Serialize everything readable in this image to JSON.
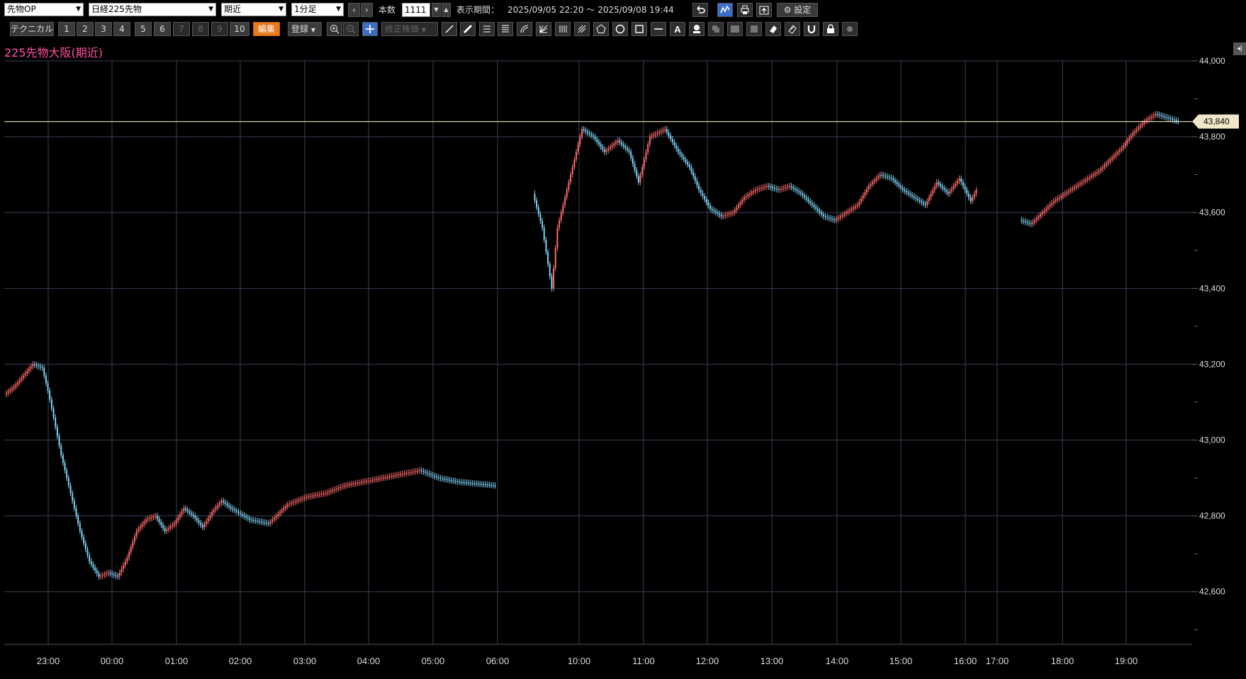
{
  "toolbar": {
    "category_select": "先物OP",
    "symbol_select": "日経225先物",
    "contract_select": "期近",
    "interval_select": "1分足",
    "prev_label": "‹",
    "next_label": "›",
    "bars_label": "本数",
    "bars_value": "1111",
    "period_label": "表示期間：",
    "period_value": "2025/09/05 22:20 ～ 2025/09/08 19:44",
    "settings_label": "設定",
    "technical_label": "テクニカル",
    "presets": [
      "1",
      "2",
      "3",
      "4",
      "5",
      "6",
      "7",
      "8",
      "9",
      "10"
    ],
    "edit_label": "編集",
    "register_label": "登録",
    "adjust_label": "修正株価"
  },
  "chart_title": "225先物大阪(期近)",
  "chart_data": {
    "type": "candlestick",
    "title": "225先物大阪(期近)",
    "x_tick_labels": [
      "23:00",
      "00:00",
      "01:00",
      "02:00",
      "03:00",
      "04:00",
      "05:00",
      "06:00",
      "10:00",
      "11:00",
      "12:00",
      "13:00",
      "14:00",
      "15:00",
      "16:00",
      "17:00",
      "18:00",
      "19:00"
    ],
    "y_tick_labels": [
      "44,000",
      "43,800",
      "43,600",
      "43,400",
      "43,200",
      "43,000",
      "42,800",
      "42,600"
    ],
    "ylim": [
      42480,
      44000
    ],
    "current_price_label": "43,840",
    "current_price": 43840,
    "colors": {
      "up": "#ff6b6b",
      "down": "#7fd3f5",
      "grid": "#3a3f55",
      "price_line": "#f1e6c8"
    },
    "series": [
      {
        "segment": "night",
        "points": [
          [
            0,
            43120
          ],
          [
            5,
            43140
          ],
          [
            10,
            43170
          ],
          [
            15,
            43200
          ],
          [
            20,
            43190
          ],
          [
            23,
            43130
          ],
          [
            26,
            43060
          ],
          [
            30,
            42960
          ],
          [
            35,
            42860
          ],
          [
            40,
            42760
          ],
          [
            45,
            42680
          ],
          [
            50,
            42640
          ],
          [
            55,
            42650
          ],
          [
            60,
            42640
          ],
          [
            65,
            42690
          ],
          [
            70,
            42760
          ],
          [
            75,
            42790
          ],
          [
            80,
            42800
          ],
          [
            85,
            42760
          ],
          [
            90,
            42780
          ],
          [
            95,
            42820
          ],
          [
            100,
            42800
          ],
          [
            105,
            42770
          ],
          [
            110,
            42810
          ],
          [
            115,
            42840
          ],
          [
            120,
            42820
          ],
          [
            130,
            42790
          ],
          [
            140,
            42780
          ],
          [
            150,
            42830
          ],
          [
            160,
            42850
          ],
          [
            170,
            42860
          ],
          [
            180,
            42880
          ],
          [
            190,
            42890
          ],
          [
            200,
            42900
          ],
          [
            210,
            42910
          ],
          [
            220,
            42920
          ],
          [
            230,
            42900
          ],
          [
            240,
            42890
          ],
          [
            260,
            42880
          ]
        ]
      },
      {
        "segment": "day",
        "points": [
          [
            280,
            43650
          ],
          [
            285,
            43560
          ],
          [
            290,
            43400
          ],
          [
            293,
            43560
          ],
          [
            297,
            43640
          ],
          [
            302,
            43740
          ],
          [
            306,
            43820
          ],
          [
            312,
            43800
          ],
          [
            318,
            43760
          ],
          [
            325,
            43790
          ],
          [
            331,
            43760
          ],
          [
            336,
            43680
          ],
          [
            342,
            43800
          ],
          [
            350,
            43820
          ],
          [
            357,
            43760
          ],
          [
            363,
            43720
          ],
          [
            368,
            43660
          ],
          [
            374,
            43610
          ],
          [
            380,
            43590
          ],
          [
            386,
            43600
          ],
          [
            392,
            43640
          ],
          [
            398,
            43660
          ],
          [
            404,
            43670
          ],
          [
            410,
            43660
          ],
          [
            416,
            43670
          ],
          [
            422,
            43650
          ],
          [
            428,
            43620
          ],
          [
            434,
            43590
          ],
          [
            440,
            43580
          ],
          [
            446,
            43600
          ],
          [
            452,
            43620
          ],
          [
            458,
            43670
          ],
          [
            464,
            43700
          ],
          [
            470,
            43690
          ],
          [
            476,
            43660
          ],
          [
            482,
            43640
          ],
          [
            488,
            43620
          ],
          [
            494,
            43680
          ],
          [
            500,
            43650
          ],
          [
            506,
            43690
          ],
          [
            512,
            43630
          ],
          [
            515,
            43660
          ]
        ]
      },
      {
        "segment": "evening",
        "points": [
          [
            538,
            43580
          ],
          [
            544,
            43570
          ],
          [
            550,
            43600
          ],
          [
            556,
            43630
          ],
          [
            562,
            43650
          ],
          [
            568,
            43670
          ],
          [
            574,
            43690
          ],
          [
            580,
            43710
          ],
          [
            586,
            43740
          ],
          [
            592,
            43770
          ],
          [
            598,
            43810
          ],
          [
            604,
            43840
          ],
          [
            610,
            43860
          ],
          [
            616,
            43850
          ],
          [
            622,
            43840
          ]
        ]
      }
    ]
  }
}
